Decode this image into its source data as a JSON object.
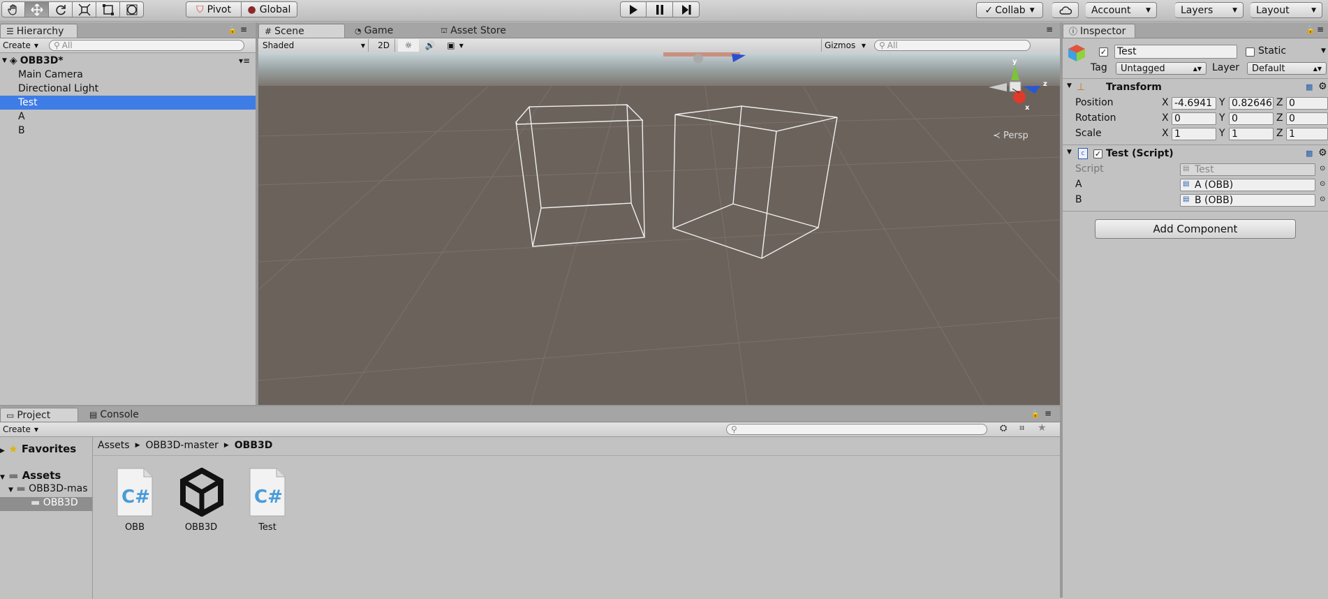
{
  "toolbar": {
    "pivot_label": "Pivot",
    "global_label": "Global",
    "collab_label": "Collab",
    "account_label": "Account",
    "layers_label": "Layers",
    "layout_label": "Layout"
  },
  "hierarchy": {
    "tab_label": "Hierarchy",
    "create_label": "Create",
    "search_placeholder": "All",
    "scene_name": "OBB3D*",
    "items": [
      "Main Camera",
      "Directional Light",
      "Test",
      "A",
      "B"
    ],
    "selected": "Test"
  },
  "scene": {
    "tabs": [
      "Scene",
      "Game",
      "Asset Store"
    ],
    "shading_mode": "Shaded",
    "mode_2d": "2D",
    "gizmos_label": "Gizmos",
    "search_placeholder": "All",
    "projection_label": "Persp",
    "axis_y": "y",
    "axis_z": "z",
    "axis_x": "x"
  },
  "inspector": {
    "tab_label": "Inspector",
    "object_name": "Test",
    "static_label": "Static",
    "tag_label": "Tag",
    "tag_value": "Untagged",
    "layer_label": "Layer",
    "layer_value": "Default",
    "transform_title": "Transform",
    "position_label": "Position",
    "rotation_label": "Rotation",
    "scale_label": "Scale",
    "axis_x": "X",
    "axis_y": "Y",
    "axis_z": "Z",
    "position": {
      "x": "-4.6941",
      "y": "0.82646",
      "z": "0"
    },
    "rotation": {
      "x": "0",
      "y": "0",
      "z": "0"
    },
    "scale": {
      "x": "1",
      "y": "1",
      "z": "1"
    },
    "script_component_title": "Test (Script)",
    "script_label": "Script",
    "script_value": "Test",
    "field_a_label": "A",
    "field_a_value": "A (OBB)",
    "field_b_label": "B",
    "field_b_value": "B (OBB)",
    "add_component_label": "Add Component"
  },
  "project": {
    "tabs": [
      "Project",
      "Console"
    ],
    "create_label": "Create",
    "favorites_label": "Favorites",
    "assets_label": "Assets",
    "tree_folder": "OBB3D-mas",
    "tree_subfolder": "OBB3D",
    "breadcrumb": [
      "Assets",
      "OBB3D-master",
      "OBB3D"
    ],
    "files": [
      {
        "name": "OBB",
        "icon": "csharp-script-icon"
      },
      {
        "name": "OBB3D",
        "icon": "unity-scene-icon"
      },
      {
        "name": "Test",
        "icon": "csharp-script-icon"
      }
    ]
  },
  "colors": {
    "selection": "#3e7ce6",
    "scene_ground": "#6b625b",
    "panel_bg": "#c2c2c2"
  }
}
